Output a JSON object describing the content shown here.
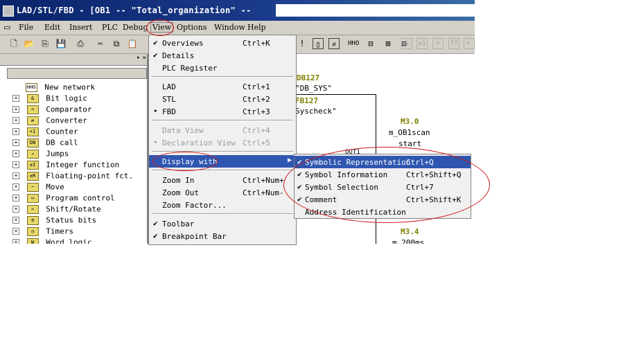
{
  "window": {
    "title": "LAD/STL/FBD  - [OB1 -- \"Total_organization\" --"
  },
  "menubar": [
    "File",
    "Edit",
    "Insert",
    "PLC",
    "Debug",
    "View",
    "Options",
    "Window",
    "Help"
  ],
  "active_menu": "View",
  "view_menu": [
    {
      "label": "Overviews",
      "shortcut": "Ctrl+K",
      "check": "✔"
    },
    {
      "label": "Details",
      "shortcut": "",
      "check": "✔"
    },
    {
      "label": "PLC Register",
      "shortcut": "",
      "check": ""
    },
    {
      "label": "LAD",
      "shortcut": "Ctrl+1",
      "check": ""
    },
    {
      "label": "STL",
      "shortcut": "Ctrl+2",
      "check": ""
    },
    {
      "label": "FBD",
      "shortcut": "Ctrl+3",
      "check": "•"
    },
    {
      "label": "Data View",
      "shortcut": "Ctrl+4",
      "check": ""
    },
    {
      "label": "Declaration View",
      "shortcut": "Ctrl+5",
      "check": "•"
    },
    {
      "label": "Display with",
      "shortcut": "",
      "check": ""
    },
    {
      "label": "Zoom In",
      "shortcut": "Ctrl+Num+",
      "check": ""
    },
    {
      "label": "Zoom Out",
      "shortcut": "Ctrl+Num-",
      "check": ""
    },
    {
      "label": "Zoom Factor...",
      "shortcut": "",
      "check": ""
    },
    {
      "label": "Toolbar",
      "shortcut": "",
      "check": "✔"
    },
    {
      "label": "Breakpoint Bar",
      "shortcut": "",
      "check": "✔"
    }
  ],
  "display_with_submenu": [
    {
      "label": "Symbolic Representation",
      "shortcut": "Ctrl+Q",
      "check": "✔"
    },
    {
      "label": "Symbol Information",
      "shortcut": "Ctrl+Shift+Q",
      "check": "✔"
    },
    {
      "label": "Symbol Selection",
      "shortcut": "Ctrl+7",
      "check": "✔"
    },
    {
      "label": "Comment",
      "shortcut": "Ctrl+Shift+K",
      "check": "✔"
    },
    {
      "label": "Address Identification",
      "shortcut": "",
      "check": ""
    }
  ],
  "tree": [
    {
      "label": "New network",
      "icon": "network-icon",
      "icon_text": "HHO"
    },
    {
      "label": "Bit logic",
      "icon": "bit-logic-icon",
      "icon_text": "&"
    },
    {
      "label": "Comparator",
      "icon": "comparator-icon",
      "icon_text": "<"
    },
    {
      "label": "Converter",
      "icon": "converter-icon",
      "icon_text": "⇄"
    },
    {
      "label": "Counter",
      "icon": "counter-icon",
      "icon_text": "+1"
    },
    {
      "label": "DB call",
      "icon": "db-call-icon",
      "icon_text": "DB"
    },
    {
      "label": "Jumps",
      "icon": "jumps-icon",
      "icon_text": "↗"
    },
    {
      "label": "Integer function",
      "icon": "integer-icon",
      "icon_text": "±I"
    },
    {
      "label": "Floating-point fct.",
      "icon": "float-icon",
      "icon_text": "±R"
    },
    {
      "label": "Move",
      "icon": "move-icon",
      "icon_text": "~"
    },
    {
      "label": "Program control",
      "icon": "program-control-icon",
      "icon_text": "▭"
    },
    {
      "label": "Shift/Rotate",
      "icon": "shift-rotate-icon",
      "icon_text": "⇔"
    },
    {
      "label": "Status bits",
      "icon": "status-bits-icon",
      "icon_text": "≡"
    },
    {
      "label": "Timers",
      "icon": "timers-icon",
      "icon_text": "◷"
    },
    {
      "label": "Word logic",
      "icon": "word-logic-icon",
      "icon_text": "W"
    }
  ],
  "workarea": {
    "db": "DB127",
    "db_sym": "\"DB_SYS\"",
    "fb": "FB127",
    "fb_sym": "Syscheck\"",
    "m1": "M3.0",
    "m1_sym": "m_OB1scan",
    "m1_sym2": "start",
    "m2": "M3.4",
    "m2_sym": "m_200ms",
    "pin": "OUT1"
  },
  "accent": "#2f56b0",
  "annotation_color": "#d01818"
}
